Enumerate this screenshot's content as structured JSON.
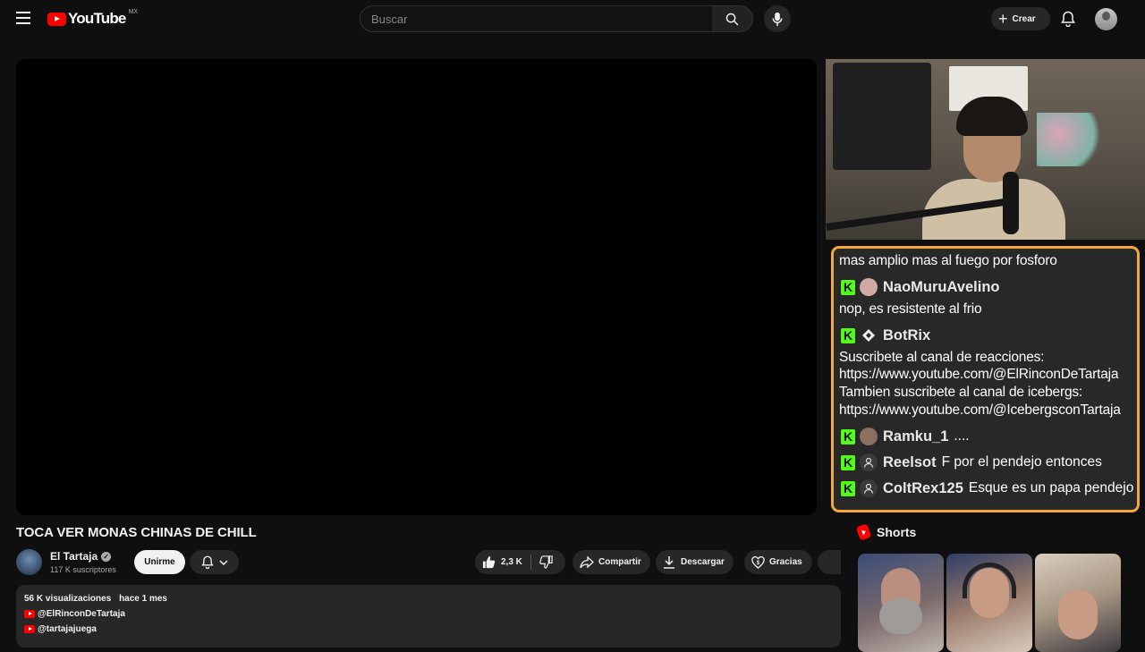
{
  "header": {
    "logo_text": "YouTube",
    "country_code": "MX",
    "search_placeholder": "Buscar",
    "create_label": "Crear"
  },
  "chat": {
    "messages": [
      {
        "kind": "text",
        "text": "mas amplio mas al fuego por fosforo"
      },
      {
        "kind": "user",
        "name": "NaoMuruAvelino",
        "text": "",
        "avatar_icon": "user-avatar-icon"
      },
      {
        "kind": "text",
        "text": "nop, es resistente al frio"
      },
      {
        "kind": "user",
        "name": "BotRix",
        "text": "",
        "avatar_icon": "bot-diamond-icon"
      },
      {
        "kind": "text",
        "text": "Suscribete al canal de reacciones:"
      },
      {
        "kind": "text",
        "text": "https://www.youtube.com/@ElRinconDeTartaja"
      },
      {
        "kind": "text",
        "text": "Tambien suscribete al canal de icebergs:"
      },
      {
        "kind": "text",
        "text": "https://www.youtube.com/@IcebergsconTartaja"
      },
      {
        "kind": "user",
        "name": "Ramku_1",
        "text": "....",
        "avatar_icon": "user-avatar-icon"
      },
      {
        "kind": "user",
        "name": "Reelsot",
        "text": "F por el pendejo entonces",
        "avatar_icon": "default-user-icon"
      },
      {
        "kind": "user",
        "name": "ColtRex125",
        "text": "Esque es un papa pendejo",
        "avatar_icon": "default-user-icon"
      }
    ],
    "badge_letter": "K",
    "colors": {
      "border": "#f3a93a",
      "badge": "#53fc18"
    }
  },
  "video": {
    "title": "TOCA VER MONAS CHINAS DE CHILL",
    "channel_name": "El Tartaja",
    "subscribers": "117 K suscriptores",
    "join_label": "Unirme",
    "likes": "2,3 K",
    "share_label": "Compartir",
    "download_label": "Descargar",
    "thanks_label": "Gracias"
  },
  "description": {
    "views": "56 K visualizaciones",
    "date": "hace 1 mes",
    "links": [
      "@ElRinconDeTartaja",
      "@tartajajuega"
    ]
  },
  "shorts": {
    "heading": "Shorts"
  }
}
